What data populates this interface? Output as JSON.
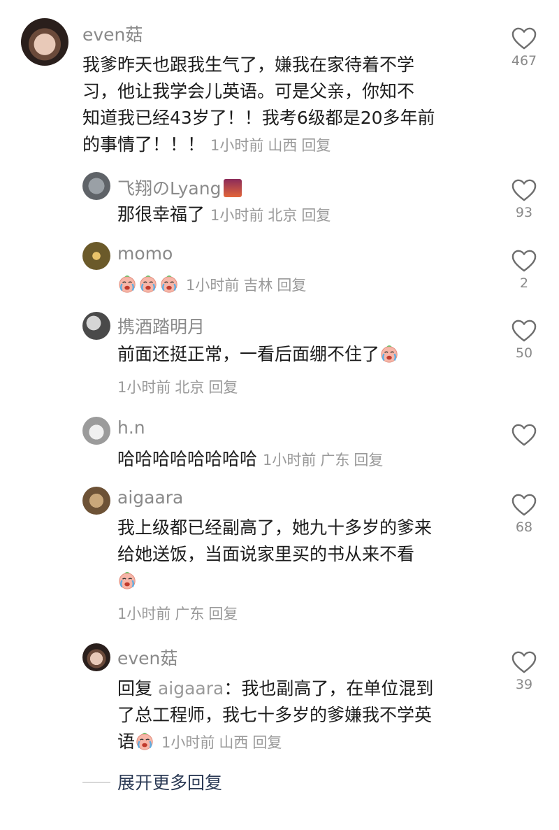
{
  "comments": [
    {
      "user": "even菇",
      "text": "我爹昨天也跟我生气了，嫌我在家待着不学习，他让我学会儿英语。可是父亲，你知不知道我已经43岁了！！我考6级都是20多年前的事情了！！！",
      "lines": [
        "我爹昨天也跟我生气了，嫌我在家待着不学",
        "习，他让我学会儿英语。可是父亲，你知不",
        "知道我已经43岁了！！我考6级都是20多年前",
        "的事情了！！！"
      ],
      "time": "1小时前",
      "location": "山西",
      "reply_label": "回复",
      "likes": "467"
    }
  ],
  "replies": [
    {
      "user": "飞翔のLyang",
      "text": "那很幸福了",
      "time": "1小时前",
      "location": "北京",
      "reply_label": "回复",
      "likes": "93"
    },
    {
      "user": "momo",
      "text": "",
      "emoji_count": 3,
      "time": "1小时前",
      "location": "吉林",
      "reply_label": "回复",
      "likes": "2"
    },
    {
      "user": "携酒踏明月",
      "text": "前面还挺正常，一看后面绷不住了",
      "time": "1小时前",
      "location": "北京",
      "reply_label": "回复",
      "likes": "50"
    },
    {
      "user": "h.n",
      "text": "哈哈哈哈哈哈哈哈",
      "time": "1小时前",
      "location": "广东",
      "reply_label": "回复",
      "likes": ""
    },
    {
      "user": "aigaara",
      "lines": [
        "我上级都已经副高了，她九十多岁的爹来",
        "给她送饭，当面说家里买的书从来不看"
      ],
      "time": "1小时前",
      "location": "广东",
      "reply_label": "回复",
      "likes": "68"
    },
    {
      "user": "even菇",
      "reply_prefix": "回复",
      "reply_to": "aigaara",
      "lines": [
        "我也副高了，在单位混到",
        "了总工程师，我七十多岁的爹嫌我不学英",
        "语"
      ],
      "time": "1小时前",
      "location": "山西",
      "reply_label": "回复",
      "likes": "39"
    }
  ],
  "expand_label": "展开更多回复",
  "colors": {
    "meta": "#9a9a9a",
    "name": "#8a8a8a",
    "expand": "#2b3a55"
  }
}
